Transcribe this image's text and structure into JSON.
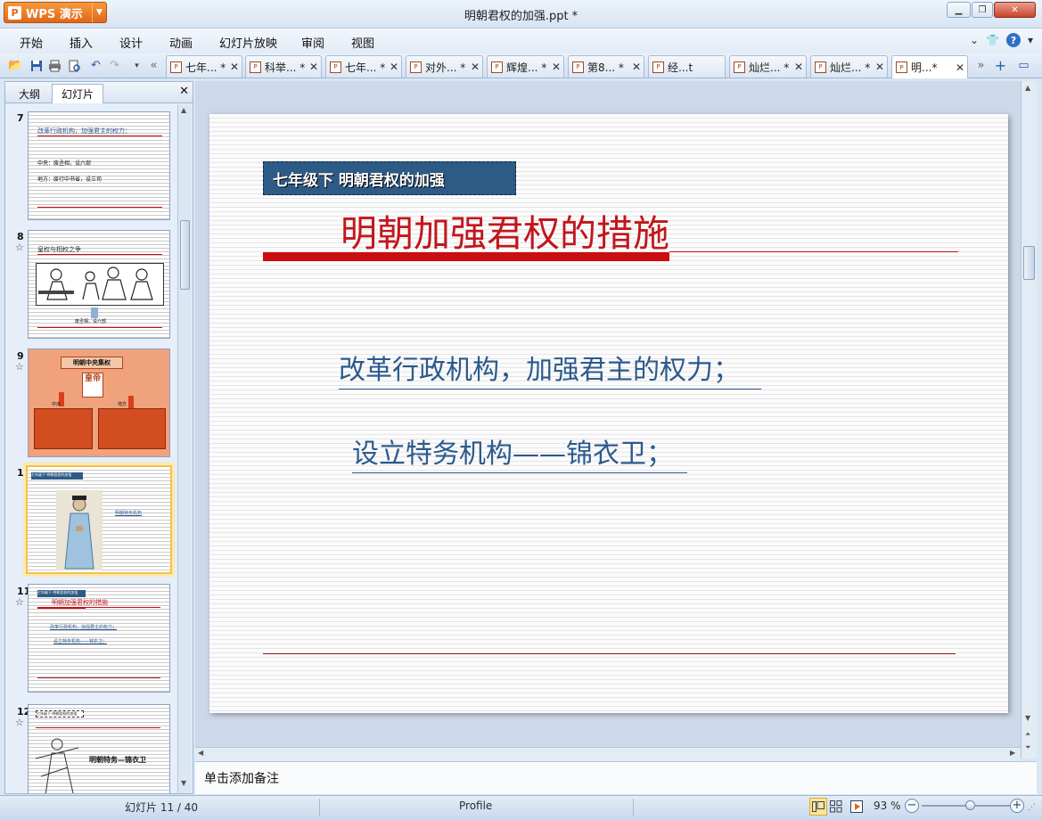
{
  "app": {
    "name": "WPS 演示",
    "logo_glyph": "P"
  },
  "window": {
    "title": "明朝君权的加强.ppt *",
    "controls": {
      "minimize": "▁",
      "restore": "❐",
      "close": "✕"
    }
  },
  "menu": [
    "开始",
    "插入",
    "设计",
    "动画",
    "幻灯片放映",
    "审阅",
    "视图"
  ],
  "doc_tabs": [
    {
      "label": "七年... *",
      "close": "✕"
    },
    {
      "label": "科举... *",
      "close": "✕"
    },
    {
      "label": "七年... *",
      "close": "✕"
    },
    {
      "label": "对外... *",
      "close": "✕"
    },
    {
      "label": "辉煌... *",
      "close": "✕"
    },
    {
      "label": "第8... *",
      "close": "✕"
    },
    {
      "label": "经...t",
      "close": ""
    },
    {
      "label": "灿烂... *",
      "close": "✕"
    },
    {
      "label": "灿烂... *",
      "close": "✕"
    },
    {
      "label": "明...*",
      "close": "✕",
      "active": true
    }
  ],
  "left_panel": {
    "tabs": [
      "大纲",
      "幻灯片"
    ],
    "active_tab": "幻灯片",
    "close": "✕",
    "thumbs": [
      {
        "num": "7",
        "star": "",
        "lines": [
          "改革行政机构，加强君主的权力：",
          "中央：废丞相，设六部",
          "地方：废行中书省，设三司"
        ]
      },
      {
        "num": "8",
        "star": "☆",
        "lines": [
          "皇权与相权之争",
          "废丞相，设六部"
        ]
      },
      {
        "num": "9",
        "star": "☆",
        "lines": [
          "明朝中央集权",
          "皇帝",
          "中央",
          "地方"
        ]
      },
      {
        "num": "10",
        "star": "",
        "lines": [
          "七年级下 明朝君权的加强",
          "明朝特务机构"
        ],
        "selected": true
      },
      {
        "num": "11",
        "star": "☆",
        "lines": [
          "七年级下 明朝君权的加强",
          "明朝加强君权的措施",
          "改革行政机构，加强君主的权力；",
          "设立特务机构——锦衣卫；"
        ]
      },
      {
        "num": "12",
        "star": "☆",
        "lines": [
          "七年级下 明朝君权的加强",
          "明朝特务—锦衣卫"
        ]
      }
    ]
  },
  "slide": {
    "label": "七年级下 明朝君权的加强",
    "title": "明朝加强君权的措施",
    "bullets": [
      "改革行政机构，加强君主的权力；",
      "设立特务机构——锦衣卫；"
    ]
  },
  "notes_placeholder": "单击添加备注",
  "status": {
    "slide_counter": "幻灯片 11 / 40",
    "profile": "Profile",
    "zoom": "93 %",
    "zoom_level_fraction": 0.55
  },
  "colors": {
    "title_red": "#c2161d",
    "bullet_blue": "#2c5a8c",
    "label_bg": "#2e5a86",
    "app_orange": "#e8731f"
  }
}
